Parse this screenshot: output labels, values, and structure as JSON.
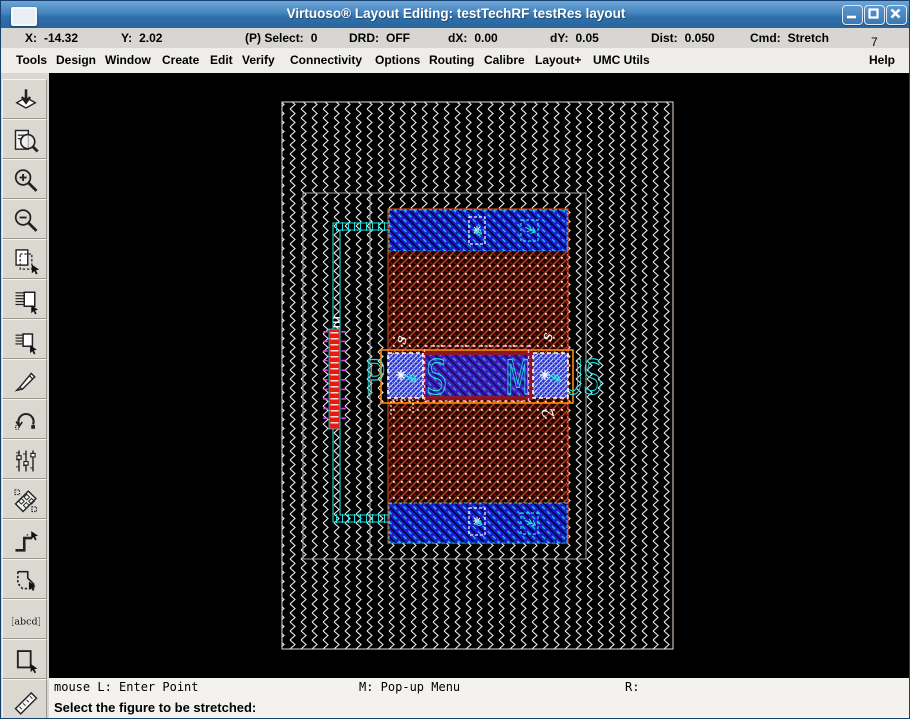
{
  "window": {
    "title": "Virtuoso® Layout Editing: testTechRF testRes layout",
    "controls": {
      "minimize": "minimize",
      "maximize": "maximize",
      "close": "close"
    }
  },
  "status_bar": {
    "items": [
      {
        "label": "X:",
        "value": "-14.32"
      },
      {
        "label": "Y:",
        "value": "2.02"
      },
      {
        "label": "(P) Select:",
        "value": "0"
      },
      {
        "label": "DRD:",
        "value": "OFF"
      },
      {
        "label": "dX:",
        "value": "0.00"
      },
      {
        "label": "dY:",
        "value": "0.05"
      },
      {
        "label": "Dist:",
        "value": "0.050"
      },
      {
        "label": "Cmd:",
        "value": "Stretch"
      }
    ],
    "counter": "7"
  },
  "menu_bar": {
    "items": [
      "Tools",
      "Design",
      "Window",
      "Create",
      "Edit",
      "Verify",
      "Connectivity",
      "Options",
      "Routing",
      "Calibre",
      "Layout+",
      "UMC Utils"
    ],
    "help": "Help"
  },
  "toolbar": {
    "icons": [
      "descend-icon",
      "fit-view-icon",
      "zoom-in-icon",
      "zoom-out-icon",
      "copy-icon",
      "move-icon",
      "stretch-icon",
      "pencil-icon",
      "rotate-icon",
      "properties-icon",
      "pick-instances-icon",
      "create-path-icon",
      "create-polygon-icon",
      "create-label-icon",
      "create-rect-icon",
      "ruler-icon"
    ]
  },
  "canvas": {
    "pin_labels": {
      "plus": "PLUS",
      "minus": "MINUS"
    },
    "decor_glyphs": {
      "g1": "s",
      "g2": "s",
      "g3": "2"
    },
    "colors": {
      "metal_blue": "#1d1dd8",
      "diff_brown": "#e8481c",
      "boundary_orange": "#ff8808",
      "highlight_cyan": "#24dede",
      "marker_pink": "#ffaccc",
      "via_red": "#e81a10",
      "substrate_hatch": "#ececec"
    }
  },
  "prompt_bar": {
    "left": "mouse L: Enter Point",
    "middle": "M: Pop-up Menu",
    "right": "R:"
  },
  "message_bar": {
    "text": "Select the figure to be stretched:"
  }
}
